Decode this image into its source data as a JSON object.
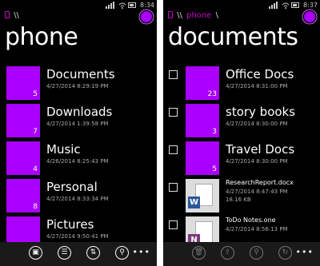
{
  "left": {
    "status": {
      "time": "8:34"
    },
    "breadcrumb": [
      "\\\\"
    ],
    "title": "phone",
    "items": [
      {
        "name": "Documents",
        "date": "4/27/2014 8:29:19 PM",
        "count": "5"
      },
      {
        "name": "Downloads",
        "date": "4/27/2014 1:39:58 PM",
        "count": "7"
      },
      {
        "name": "Music",
        "date": "4/26/2014 8:25:43 PM",
        "count": "4"
      },
      {
        "name": "Personal",
        "date": "4/27/2014 8:33:34 PM",
        "count": "8"
      },
      {
        "name": "Pictures",
        "date": "4/27/2014 9:50:41 PM",
        "count": ""
      }
    ],
    "appbar": [
      "new-folder-icon",
      "select-icon",
      "sort-icon",
      "search-icon"
    ]
  },
  "right": {
    "status": {
      "time": "8:37"
    },
    "breadcrumb": [
      "\\\\",
      "phone",
      "\\"
    ],
    "title": "documents",
    "folders": [
      {
        "name": "Office Docs",
        "date": "4/27/2014 8:31:00 PM",
        "count": "23"
      },
      {
        "name": "story books",
        "date": "4/27/2014 8:30:00 PM",
        "count": "3"
      },
      {
        "name": "Travel Docs",
        "date": "4/27/2014 8:30:00 PM",
        "count": "5"
      }
    ],
    "files": [
      {
        "name": "ResearchReport.docx",
        "date": "4/27/2014 8:47:43 PM",
        "size": "18.16 KB",
        "badge": "W",
        "badge_color": "#2b579a"
      },
      {
        "name": "ToDo Notes.one",
        "date": "4/27/2014 8:56:13 PM",
        "size": "",
        "badge": "N",
        "badge_color": "#80397b"
      }
    ],
    "appbar": [
      "delete-icon",
      "share-icon",
      "pin-icon",
      "sync-icon"
    ]
  },
  "colors": {
    "accent": "#a000ff",
    "background": "#000000"
  }
}
